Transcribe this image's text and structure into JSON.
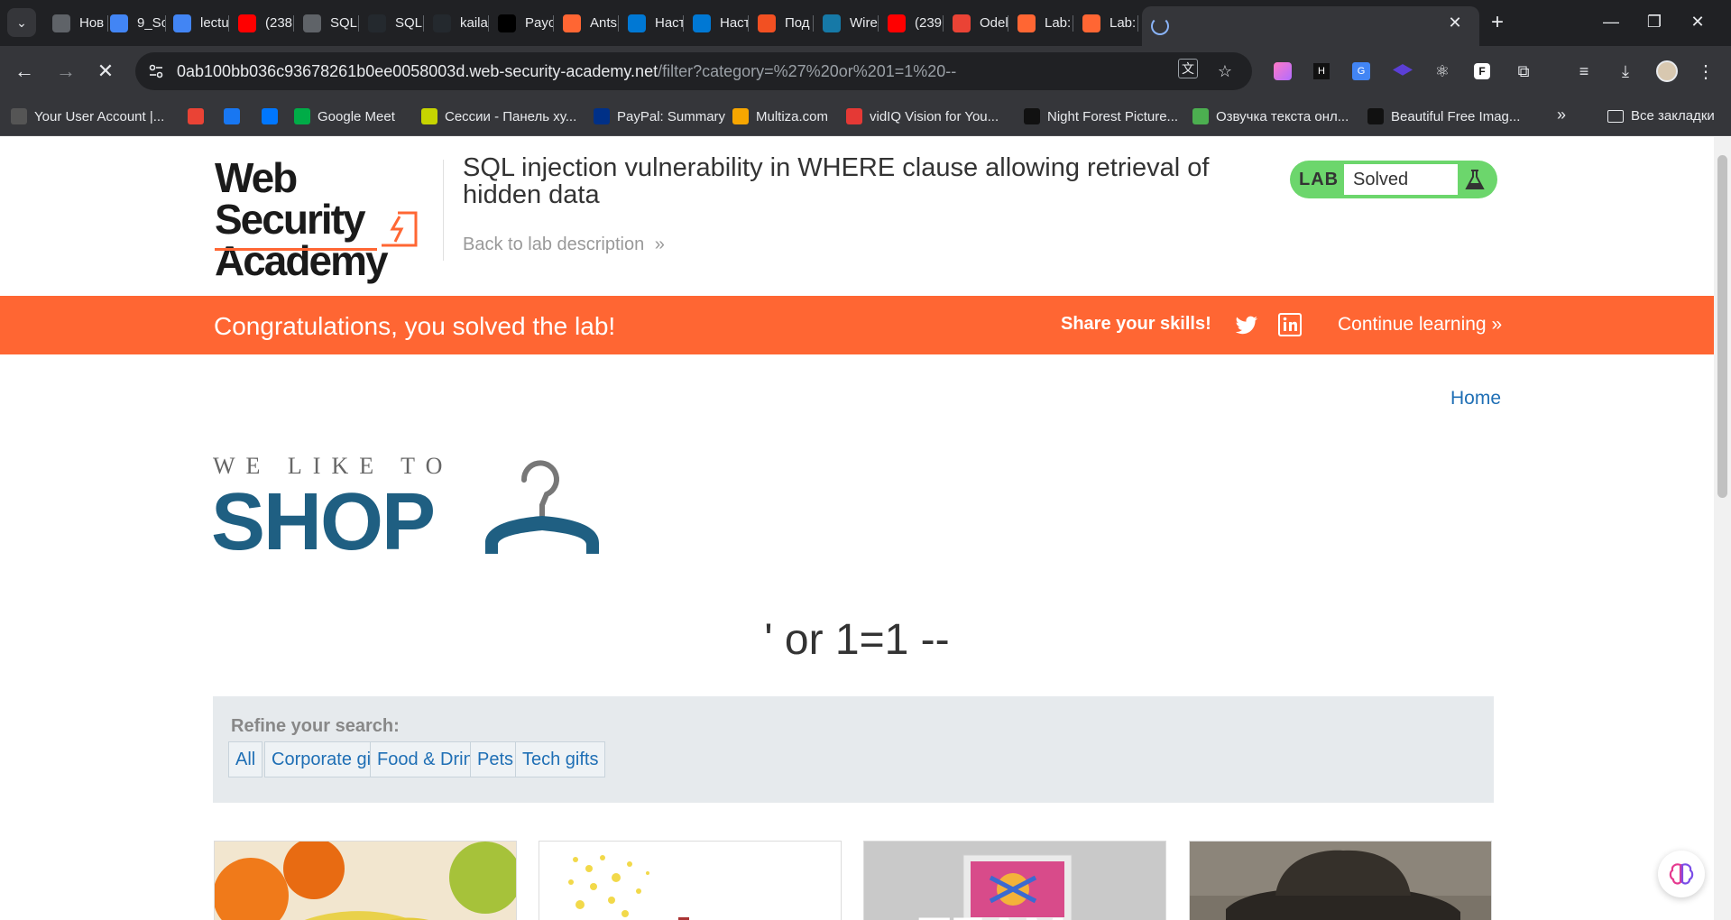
{
  "browser": {
    "tabs": [
      {
        "label": "Нов",
        "icon": "chrome-icon",
        "color": "#5f6368"
      },
      {
        "label": "9_So",
        "icon": "ai-swoosh-icon",
        "color": "#4285f4"
      },
      {
        "label": "lectu",
        "icon": "ai-swoosh-icon",
        "color": "#4285f4"
      },
      {
        "label": "(238",
        "icon": "youtube-icon",
        "color": "#ff0000"
      },
      {
        "label": "SQLi",
        "icon": "database-icon",
        "color": "#5f6368"
      },
      {
        "label": "SQL",
        "icon": "github-icon",
        "color": "#24292e"
      },
      {
        "label": "kaila",
        "icon": "github-icon",
        "color": "#24292e"
      },
      {
        "label": "Payo",
        "icon": "p-icon",
        "color": "#000000"
      },
      {
        "label": "Ants",
        "icon": "b-icon",
        "color": "#ff6633"
      },
      {
        "label": "Наст",
        "icon": "windows-icon",
        "color": "#0078d4"
      },
      {
        "label": "Наст",
        "icon": "windows-icon",
        "color": "#0078d4"
      },
      {
        "label": "Под",
        "icon": "microsoft-icon",
        "color": "#f25022"
      },
      {
        "label": "Wire",
        "icon": "wireshark-icon",
        "color": "#1679a7"
      },
      {
        "label": "(239",
        "icon": "youtube-icon",
        "color": "#ff0000"
      },
      {
        "label": "Odel",
        "icon": "gmail-icon",
        "color": "#ea4335"
      },
      {
        "label": "Lab:",
        "icon": "portswigger-icon",
        "color": "#ff6633"
      },
      {
        "label": "Lab:",
        "icon": "portswigger-icon",
        "color": "#ff6633"
      }
    ],
    "url_host": "0ab100bb036c93678261b0ee0058003d.web-security-academy.net",
    "url_path": "/filter?category=%27%20or%201=1%20--",
    "bookmarks": [
      {
        "label": "Your User Account |...",
        "icon": "account-icon",
        "color": "#555555"
      },
      {
        "label": "",
        "icon": "gmail-icon",
        "color": "#ea4335"
      },
      {
        "label": "",
        "icon": "facebook-icon",
        "color": "#1877f2"
      },
      {
        "label": "",
        "icon": "vk-icon",
        "color": "#0077ff"
      },
      {
        "label": "Google Meet",
        "icon": "google-meet-icon",
        "color": "#00ac47"
      },
      {
        "label": "Сессии - Панель ху...",
        "icon": "live-icon",
        "color": "#c6d400"
      },
      {
        "label": "PayPal: Summary",
        "icon": "paypal-icon",
        "color": "#003087"
      },
      {
        "label": "Multiza.com",
        "icon": "multiza-icon",
        "color": "#f7a600"
      },
      {
        "label": "vidIQ Vision for You...",
        "icon": "vidiq-icon",
        "color": "#e53935"
      },
      {
        "label": "Night Forest Picture...",
        "icon": "unsplash-icon",
        "color": "#111111"
      },
      {
        "label": "Озвучка текста онл...",
        "icon": "speaker-icon",
        "color": "#4caf50"
      },
      {
        "label": "Beautiful Free Imag...",
        "icon": "unsplash-icon",
        "color": "#111111"
      }
    ],
    "bookmarks_more": "»",
    "all_bookmarks": "Все закладки"
  },
  "lab": {
    "logo_line1": "Web Security",
    "logo_line2": "Academy",
    "title": "SQL injection vulnerability in WHERE clause allowing retrieval of hidden data",
    "back_link": "Back to lab description",
    "status_tag": "LAB",
    "status_value": "Solved",
    "status_color": "#6cd66c"
  },
  "banner": {
    "message": "Congratulations, you solved the lab!",
    "share": "Share your skills!",
    "continue": "Continue learning",
    "color": "#ff6633"
  },
  "shop": {
    "home_link": "Home",
    "tagline": "WE LIKE TO",
    "brand": "SHOP",
    "search_term": "' or 1=1 --",
    "refine_label": "Refine your search:",
    "filters": [
      "All",
      "Corporate gifts",
      "Food & Drink",
      "Pets",
      "Tech gifts"
    ],
    "accent_color": "#1f5f82"
  }
}
